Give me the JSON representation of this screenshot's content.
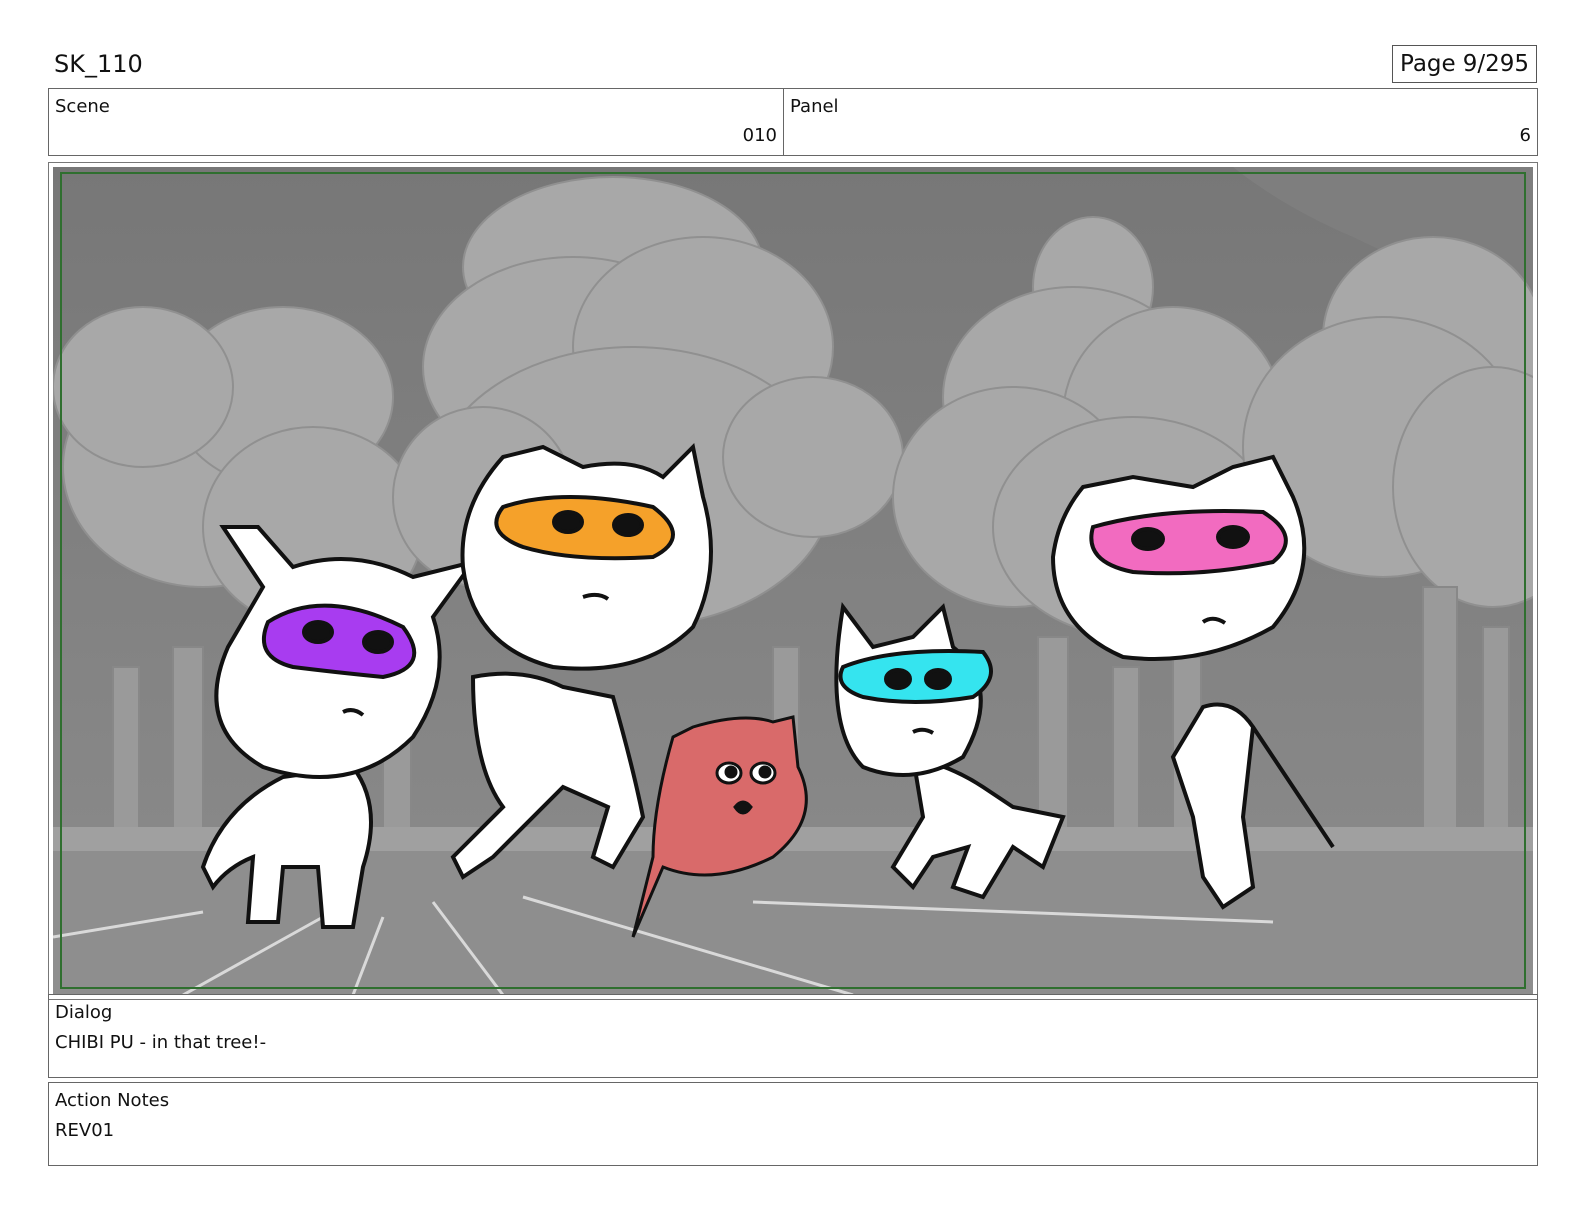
{
  "header": {
    "title": "SK_110",
    "page_label": "Page",
    "page_number": "9/295"
  },
  "scene": {
    "label": "Scene",
    "value": "010"
  },
  "panel": {
    "label": "Panel",
    "value": "6"
  },
  "dialog": {
    "label": "Dialog",
    "text": "CHIBI PU - in that tree!-"
  },
  "action_notes": {
    "label": "Action Notes",
    "text": "REV01"
  },
  "colors": {
    "purple_mask": "#a83cf0",
    "orange_mask": "#f5a12a",
    "cyan_mask": "#35e4ef",
    "pink_mask": "#f26bc0",
    "red_cat": "#d96a6a",
    "safe_frame": "#2f6f2f"
  }
}
